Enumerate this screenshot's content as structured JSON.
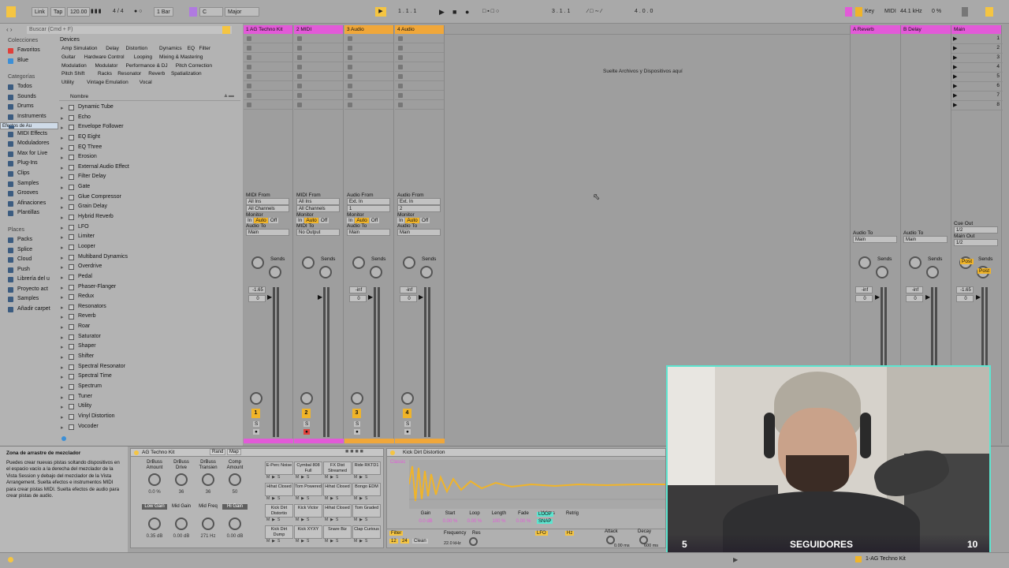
{
  "toolbar": {
    "link": "Link",
    "tap": "Tap",
    "tempo": "120.00",
    "signature": "4 / 4",
    "quantize": "1 Bar",
    "key": "C",
    "scale": "Major",
    "position": "1 . 1 . 1",
    "loop_start": "3 . 1 . 1",
    "loop_len": "4 . 0 . 0",
    "key_label": "Key",
    "midi_label": "MIDI",
    "sample_rate": "44.1 kHz",
    "cpu": "0 %"
  },
  "browser": {
    "search_placeholder": "Buscar (Cmd + F)",
    "collections_label": "Colecciones",
    "collections": [
      "Favoritos",
      "Blue"
    ],
    "categories_label": "Categorías",
    "categories": [
      "Todos",
      "Sounds",
      "Drums",
      "Instruments",
      "Efectos de Au",
      "MIDI Effects",
      "Moduladores",
      "Max for Live",
      "Plug-Ins",
      "Clips",
      "Samples",
      "Grooves",
      "Afinaciones",
      "Plantillas"
    ],
    "places_label": "Places",
    "places": [
      "Packs",
      "Splice",
      "Cloud",
      "Push",
      "Librería del u",
      "Proyecto act",
      "Samples",
      "Añadir carpet"
    ],
    "devices_label": "Devices",
    "tags": [
      [
        "Amp Simulation",
        "Delay",
        "Distortion",
        "Dynamics",
        "EQ",
        "Filter"
      ],
      [
        "Guitar",
        "Hardware Control",
        "Looping",
        "Mixing & Mastering"
      ],
      [
        "Modulation",
        "Modulator",
        "Performance & DJ",
        "Pitch Correction"
      ],
      [
        "Pitch Shift",
        "Racks",
        "Resonator",
        "Reverb",
        "Spatialization"
      ],
      [
        "Utility",
        "Vintage Emulation",
        "Vocal"
      ]
    ],
    "name_header": "Nombre",
    "files": [
      "Dynamic Tube",
      "Echo",
      "Envelope Follower",
      "EQ Eight",
      "EQ Three",
      "Erosion",
      "External Audio Effect",
      "Filter Delay",
      "Gate",
      "Glue Compressor",
      "Grain Delay",
      "Hybrid Reverb",
      "LFO",
      "Limiter",
      "Looper",
      "Multiband Dynamics",
      "Overdrive",
      "Pedal",
      "Phaser-Flanger",
      "Redux",
      "Resonators",
      "Reverb",
      "Roar",
      "Saturator",
      "Shaper",
      "Shifter",
      "Spectral Resonator",
      "Spectral Time",
      "Spectrum",
      "Tuner",
      "Utility",
      "Vinyl Distortion",
      "Vocoder"
    ]
  },
  "tracks": [
    {
      "name": "1 AG Techno Kit",
      "color": "#e25ad8",
      "from": "MIDI From",
      "src": "All Ins",
      "ch": "All Channels",
      "to_label": "Audio To",
      "to": "Main",
      "vol": "-1.65",
      "pan": "0",
      "num": "1"
    },
    {
      "name": "2 MIDI",
      "color": "#e25ad8",
      "from": "MIDI From",
      "src": "All Ins",
      "ch": "All Channels",
      "to_label": "MIDI To",
      "to": "No Output",
      "vol": "",
      "pan": "",
      "num": "2"
    },
    {
      "name": "3 Audio",
      "color": "#f0a73a",
      "from": "Audio From",
      "src": "Ext. In",
      "ch": "1",
      "to_label": "Audio To",
      "to": "Main",
      "vol": "-inf",
      "pan": "0",
      "num": "3"
    },
    {
      "name": "4 Audio",
      "color": "#f0a73a",
      "from": "Audio From",
      "src": "Ext. In",
      "ch": "2",
      "to_label": "Audio To",
      "to": "Main",
      "vol": "-inf",
      "pan": "0",
      "num": "4"
    }
  ],
  "returns": [
    {
      "name": "A Reverb",
      "color": "#e25ad8",
      "to_label": "Audio To",
      "to": "Main",
      "vol": "-inf",
      "pan": "0"
    },
    {
      "name": "B Delay",
      "color": "#e25ad8",
      "to_label": "Audio To",
      "to": "Main",
      "vol": "-inf",
      "pan": "0"
    },
    {
      "name": "Main",
      "color": "#e25ad8",
      "cue_label": "Cue Out",
      "cue": "1/2",
      "main_label": "Main Out",
      "main": "1/2",
      "vol": "-1.65",
      "pan": "0"
    }
  ],
  "monitor": {
    "label": "Monitor",
    "in": "In",
    "auto": "Auto",
    "off": "Off",
    "sends": "Sends",
    "post": "Post"
  },
  "main_scenes": [
    "1",
    "2",
    "3",
    "4",
    "5",
    "6",
    "7",
    "8"
  ],
  "drop_hint": "Suelte Archivos y Dispositivos aquí",
  "info": {
    "title": "Zona de arrastre de mezclador",
    "text": "Puedes crear nuevas pistas soltando dispositivos en el espacio vacío a la derecha del mezclador de la Vista Session y debajo del mezclador de la Vista Arrangement. Suelta efectos e instrumentos MIDI para crear pistas MIDI. Suelta efectos de audio para crear pistas de audio."
  },
  "drum_rack": {
    "name": "AG Techno Kit",
    "rand": "Rand",
    "map": "Map",
    "macros": [
      "DrBuss Amount",
      "DrBuss Drive",
      "DrBuss Transien",
      "Comp Amount",
      "Low Gain",
      "Mid Gain",
      "Mid Freq",
      "Hi Gain"
    ],
    "macro_vals": [
      "0.0 %",
      "36",
      "36",
      "50",
      "0.35 dB",
      "0.00 dB",
      "271 Hz",
      "0.00 dB"
    ],
    "pads": [
      "E-Perc Noise",
      "Cymbal 808 Full",
      "FX Dist Streamed",
      "Ride RKTD1",
      "Hihat Closed",
      "Tom Powered",
      "Hihat Closed",
      "Bongo EDM",
      "Kick Dirt Distortio",
      "Kick Victor",
      "Hihat Closed",
      "Tom Graded",
      "Kick Dirt Dump",
      "Kick XYXY",
      "Snare Biz",
      "Clap Curious"
    ]
  },
  "simpler": {
    "name": "Kick Dirt Distortion",
    "mode": "Classic",
    "params": [
      "Gain",
      "Start",
      "Loop",
      "Length",
      "Fade",
      "Voices",
      "Retrig"
    ],
    "vals": [
      "0.0 dB",
      "0.00 %",
      "0.00 %",
      "100 %",
      "0.00 %",
      "6"
    ],
    "loop": "LOOP",
    "snap": "SNAP",
    "filter": "Filter",
    "lfo": "LFO",
    "hz": "Hz",
    "attack": "Attack",
    "decay": "Decay",
    "frequency": "Frequency",
    "res": "Res",
    "freq_val": "22.0 kHz",
    "attack_val": "0.00 ms",
    "decay_val": "600 ms",
    "filter_a": "12",
    "filter_b": "24",
    "clean": "Clean"
  },
  "webcam": {
    "left": "5",
    "label": "SEGUIDORES",
    "right": "10"
  },
  "status": {
    "track": "1-AG Techno Kit"
  }
}
